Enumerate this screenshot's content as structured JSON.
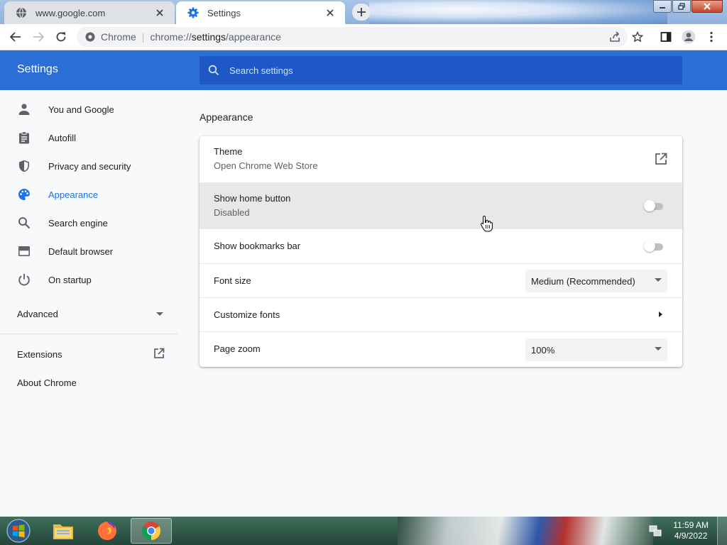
{
  "tabs": [
    {
      "title": "www.google.com",
      "active": false
    },
    {
      "title": "Settings",
      "active": true
    }
  ],
  "omnibox": {
    "site_label": "Chrome",
    "url_prefix": "chrome://",
    "url_host": "settings",
    "url_path": "/appearance"
  },
  "settings": {
    "title": "Settings",
    "search_placeholder": "Search settings"
  },
  "sidebar": {
    "items": [
      {
        "label": "You and Google",
        "icon": "person-icon",
        "selected": false
      },
      {
        "label": "Autofill",
        "icon": "clipboard-icon",
        "selected": false
      },
      {
        "label": "Privacy and security",
        "icon": "shield-icon",
        "selected": false
      },
      {
        "label": "Appearance",
        "icon": "palette-icon",
        "selected": true
      },
      {
        "label": "Search engine",
        "icon": "search-icon",
        "selected": false
      },
      {
        "label": "Default browser",
        "icon": "browser-icon",
        "selected": false
      },
      {
        "label": "On startup",
        "icon": "power-icon",
        "selected": false
      }
    ],
    "advanced_label": "Advanced",
    "extensions_label": "Extensions",
    "about_label": "About Chrome"
  },
  "appearance": {
    "section_title": "Appearance",
    "theme": {
      "label": "Theme",
      "sublabel": "Open Chrome Web Store"
    },
    "home_button": {
      "label": "Show home button",
      "sublabel": "Disabled",
      "enabled": false
    },
    "bookmarks_bar": {
      "label": "Show bookmarks bar",
      "enabled": false
    },
    "font_size": {
      "label": "Font size",
      "value": "Medium (Recommended)"
    },
    "customize_fonts": {
      "label": "Customize fonts"
    },
    "page_zoom": {
      "label": "Page zoom",
      "value": "100%"
    }
  },
  "taskbar": {
    "time": "11:59 AM",
    "date": "4/9/2022"
  },
  "colors": {
    "accent": "#1a73e8",
    "header_bg": "#2b6fd6"
  }
}
